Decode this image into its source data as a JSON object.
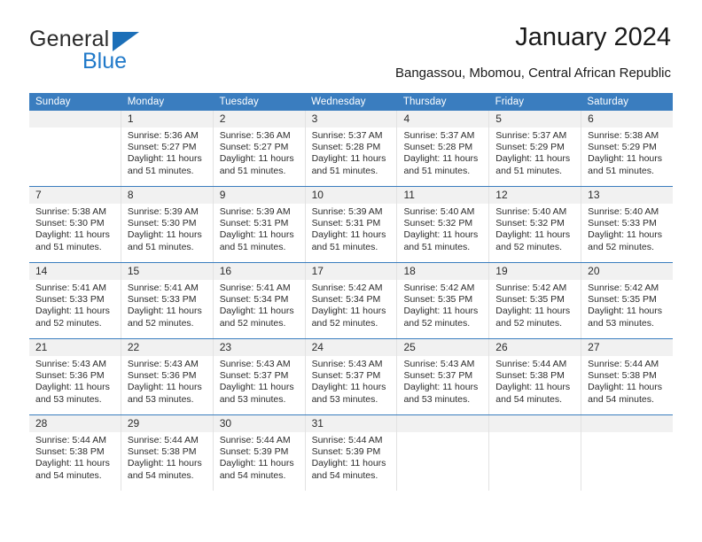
{
  "brand": {
    "name_top": "General",
    "name_bottom": "Blue",
    "color_dark": "#2b2b2b",
    "color_blue": "#2079c9",
    "triangle_color": "#1c6fb8"
  },
  "header": {
    "title": "January 2024",
    "subtitle": "Bangassou, Mbomou, Central African Republic"
  },
  "theme": {
    "header_bg": "#3a7dbf",
    "header_text": "#ffffff",
    "daynum_bg": "#f1f1f1",
    "cell_border": "#e2e2e2"
  },
  "calendar": {
    "weekday_headers": [
      "Sunday",
      "Monday",
      "Tuesday",
      "Wednesday",
      "Thursday",
      "Friday",
      "Saturday"
    ],
    "weeks": [
      [
        {
          "day": "",
          "lines": []
        },
        {
          "day": "1",
          "lines": [
            "Sunrise: 5:36 AM",
            "Sunset: 5:27 PM",
            "Daylight: 11 hours",
            "and 51 minutes."
          ]
        },
        {
          "day": "2",
          "lines": [
            "Sunrise: 5:36 AM",
            "Sunset: 5:27 PM",
            "Daylight: 11 hours",
            "and 51 minutes."
          ]
        },
        {
          "day": "3",
          "lines": [
            "Sunrise: 5:37 AM",
            "Sunset: 5:28 PM",
            "Daylight: 11 hours",
            "and 51 minutes."
          ]
        },
        {
          "day": "4",
          "lines": [
            "Sunrise: 5:37 AM",
            "Sunset: 5:28 PM",
            "Daylight: 11 hours",
            "and 51 minutes."
          ]
        },
        {
          "day": "5",
          "lines": [
            "Sunrise: 5:37 AM",
            "Sunset: 5:29 PM",
            "Daylight: 11 hours",
            "and 51 minutes."
          ]
        },
        {
          "day": "6",
          "lines": [
            "Sunrise: 5:38 AM",
            "Sunset: 5:29 PM",
            "Daylight: 11 hours",
            "and 51 minutes."
          ]
        }
      ],
      [
        {
          "day": "7",
          "lines": [
            "Sunrise: 5:38 AM",
            "Sunset: 5:30 PM",
            "Daylight: 11 hours",
            "and 51 minutes."
          ]
        },
        {
          "day": "8",
          "lines": [
            "Sunrise: 5:39 AM",
            "Sunset: 5:30 PM",
            "Daylight: 11 hours",
            "and 51 minutes."
          ]
        },
        {
          "day": "9",
          "lines": [
            "Sunrise: 5:39 AM",
            "Sunset: 5:31 PM",
            "Daylight: 11 hours",
            "and 51 minutes."
          ]
        },
        {
          "day": "10",
          "lines": [
            "Sunrise: 5:39 AM",
            "Sunset: 5:31 PM",
            "Daylight: 11 hours",
            "and 51 minutes."
          ]
        },
        {
          "day": "11",
          "lines": [
            "Sunrise: 5:40 AM",
            "Sunset: 5:32 PM",
            "Daylight: 11 hours",
            "and 51 minutes."
          ]
        },
        {
          "day": "12",
          "lines": [
            "Sunrise: 5:40 AM",
            "Sunset: 5:32 PM",
            "Daylight: 11 hours",
            "and 52 minutes."
          ]
        },
        {
          "day": "13",
          "lines": [
            "Sunrise: 5:40 AM",
            "Sunset: 5:33 PM",
            "Daylight: 11 hours",
            "and 52 minutes."
          ]
        }
      ],
      [
        {
          "day": "14",
          "lines": [
            "Sunrise: 5:41 AM",
            "Sunset: 5:33 PM",
            "Daylight: 11 hours",
            "and 52 minutes."
          ]
        },
        {
          "day": "15",
          "lines": [
            "Sunrise: 5:41 AM",
            "Sunset: 5:33 PM",
            "Daylight: 11 hours",
            "and 52 minutes."
          ]
        },
        {
          "day": "16",
          "lines": [
            "Sunrise: 5:41 AM",
            "Sunset: 5:34 PM",
            "Daylight: 11 hours",
            "and 52 minutes."
          ]
        },
        {
          "day": "17",
          "lines": [
            "Sunrise: 5:42 AM",
            "Sunset: 5:34 PM",
            "Daylight: 11 hours",
            "and 52 minutes."
          ]
        },
        {
          "day": "18",
          "lines": [
            "Sunrise: 5:42 AM",
            "Sunset: 5:35 PM",
            "Daylight: 11 hours",
            "and 52 minutes."
          ]
        },
        {
          "day": "19",
          "lines": [
            "Sunrise: 5:42 AM",
            "Sunset: 5:35 PM",
            "Daylight: 11 hours",
            "and 52 minutes."
          ]
        },
        {
          "day": "20",
          "lines": [
            "Sunrise: 5:42 AM",
            "Sunset: 5:35 PM",
            "Daylight: 11 hours",
            "and 53 minutes."
          ]
        }
      ],
      [
        {
          "day": "21",
          "lines": [
            "Sunrise: 5:43 AM",
            "Sunset: 5:36 PM",
            "Daylight: 11 hours",
            "and 53 minutes."
          ]
        },
        {
          "day": "22",
          "lines": [
            "Sunrise: 5:43 AM",
            "Sunset: 5:36 PM",
            "Daylight: 11 hours",
            "and 53 minutes."
          ]
        },
        {
          "day": "23",
          "lines": [
            "Sunrise: 5:43 AM",
            "Sunset: 5:37 PM",
            "Daylight: 11 hours",
            "and 53 minutes."
          ]
        },
        {
          "day": "24",
          "lines": [
            "Sunrise: 5:43 AM",
            "Sunset: 5:37 PM",
            "Daylight: 11 hours",
            "and 53 minutes."
          ]
        },
        {
          "day": "25",
          "lines": [
            "Sunrise: 5:43 AM",
            "Sunset: 5:37 PM",
            "Daylight: 11 hours",
            "and 53 minutes."
          ]
        },
        {
          "day": "26",
          "lines": [
            "Sunrise: 5:44 AM",
            "Sunset: 5:38 PM",
            "Daylight: 11 hours",
            "and 54 minutes."
          ]
        },
        {
          "day": "27",
          "lines": [
            "Sunrise: 5:44 AM",
            "Sunset: 5:38 PM",
            "Daylight: 11 hours",
            "and 54 minutes."
          ]
        }
      ],
      [
        {
          "day": "28",
          "lines": [
            "Sunrise: 5:44 AM",
            "Sunset: 5:38 PM",
            "Daylight: 11 hours",
            "and 54 minutes."
          ]
        },
        {
          "day": "29",
          "lines": [
            "Sunrise: 5:44 AM",
            "Sunset: 5:38 PM",
            "Daylight: 11 hours",
            "and 54 minutes."
          ]
        },
        {
          "day": "30",
          "lines": [
            "Sunrise: 5:44 AM",
            "Sunset: 5:39 PM",
            "Daylight: 11 hours",
            "and 54 minutes."
          ]
        },
        {
          "day": "31",
          "lines": [
            "Sunrise: 5:44 AM",
            "Sunset: 5:39 PM",
            "Daylight: 11 hours",
            "and 54 minutes."
          ]
        },
        {
          "day": "",
          "lines": []
        },
        {
          "day": "",
          "lines": []
        },
        {
          "day": "",
          "lines": []
        }
      ]
    ]
  }
}
